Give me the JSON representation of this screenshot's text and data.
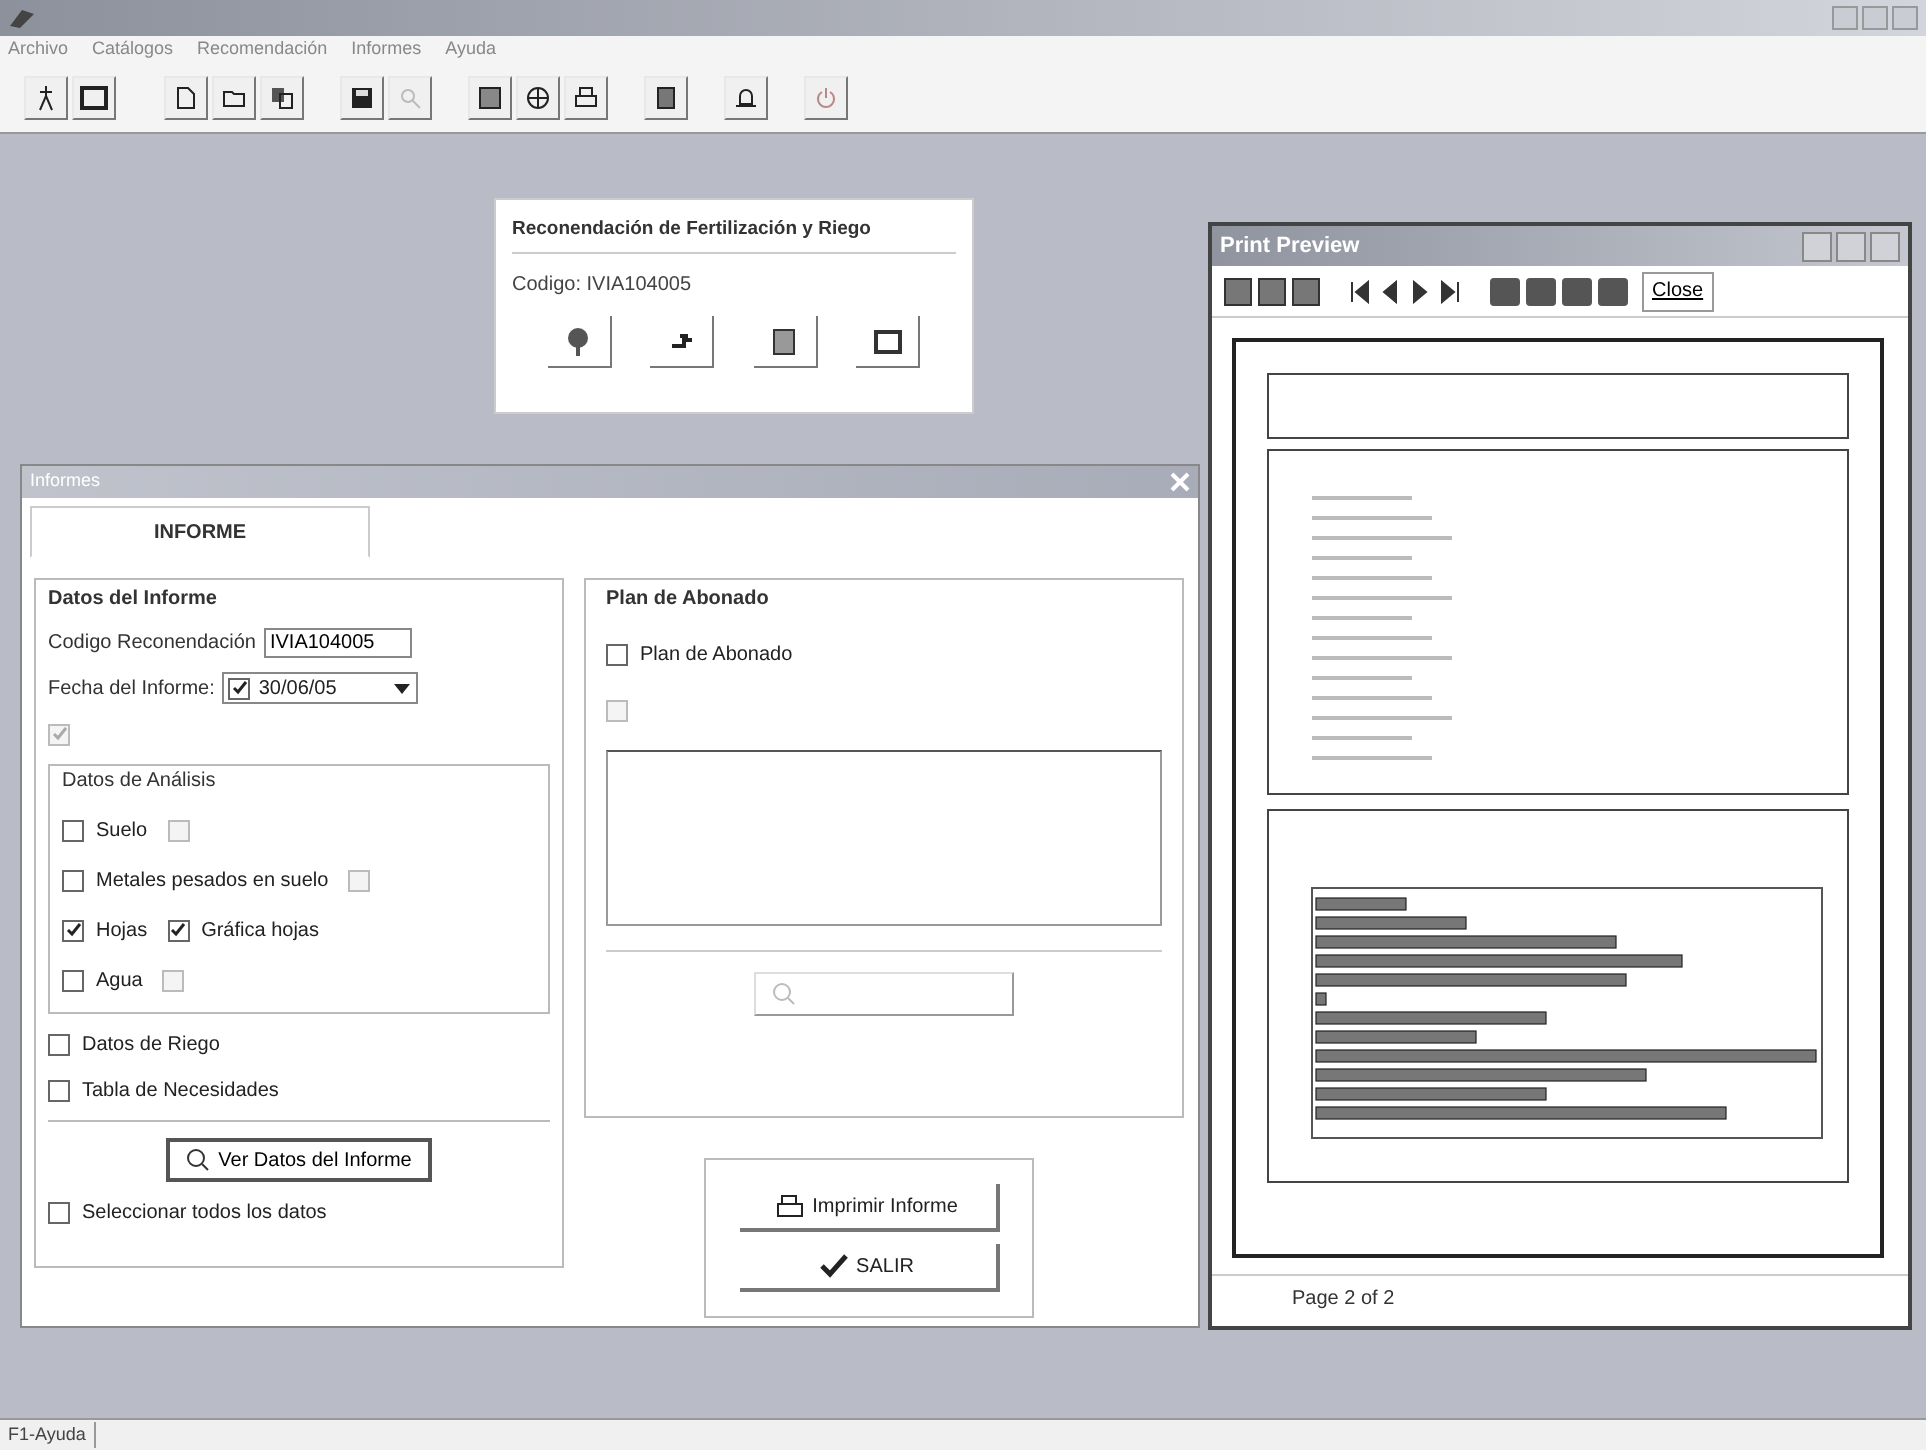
{
  "menu": [
    "Archivo",
    "Catálogos",
    "Recomendación",
    "Informes",
    "Ayuda"
  ],
  "recommendation_panel": {
    "title": "Reconendación de Fertilización y Riego",
    "code": "Codigo: IVIA104005"
  },
  "report_window": {
    "title": "Informes",
    "tabs": [
      {
        "label": "INFORME",
        "selected": true
      }
    ],
    "report_data": {
      "title": "Datos del Informe",
      "code_label": "Codigo Reconendación",
      "code_value": "IVIA104005",
      "date_label": "Fecha del Informe:",
      "date_checked": true,
      "date_value": "30/06/05",
      "merge_option": {
        "checked": true,
        "disabled": true
      },
      "analysis": {
        "title": "Datos de Análisis",
        "rows": [
          [
            {
              "label": "Suelo",
              "checked": false,
              "disabled": false
            },
            {
              "checked": false,
              "disabled": true
            }
          ],
          [
            {
              "label": "Metales pesados en suelo",
              "checked": false,
              "disabled": false
            },
            {
              "checked": false,
              "disabled": true
            }
          ],
          [
            {
              "label": "Hojas",
              "checked": true,
              "disabled": false
            },
            {
              "label": "Gráfica hojas",
              "checked": true,
              "disabled": false
            }
          ],
          [
            {
              "label": "Agua",
              "checked": false,
              "disabled": false
            },
            {
              "checked": false,
              "disabled": true
            }
          ]
        ]
      },
      "extra_options": [
        {
          "label": "Datos de Riego",
          "checked": false
        },
        {
          "label": "Tabla de Necesidades",
          "checked": false
        }
      ],
      "view_button": "Ver Datos del Informe",
      "select_all": {
        "label": "Seleccionar todos los datos",
        "checked": false
      }
    },
    "plan": {
      "title": "Plan de Abonado",
      "options": [
        {
          "label": "Plan de Abonado",
          "checked": false,
          "disabled": false
        },
        {
          "checked": false,
          "disabled": true
        }
      ]
    },
    "actions": [
      "Imprimir Informe",
      "SALIR"
    ]
  },
  "print_preview": {
    "title": "Print Preview",
    "close_button": "Close",
    "page_status": "Page 2 of 2"
  },
  "status_bar": "F1-Ayuda"
}
